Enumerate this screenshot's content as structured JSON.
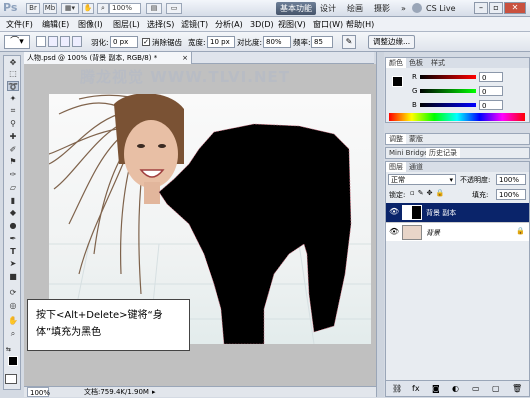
{
  "titlebar": {
    "logo": "Ps",
    "zoom": "100%",
    "workspaces": [
      "基本功能",
      "设计",
      "绘画",
      "摄影"
    ],
    "more": "»",
    "cs_live": "CS Live"
  },
  "menu": [
    "文件(F)",
    "编辑(E)",
    "图像(I)",
    "图层(L)",
    "选择(S)",
    "滤镜(T)",
    "分析(A)",
    "3D(D)",
    "视图(V)",
    "窗口(W)",
    "帮助(H)"
  ],
  "options": {
    "feather_label": "羽化:",
    "feather_value": "0 px",
    "antialias_label": "消除锯齿",
    "width_label": "宽度:",
    "width_value": "10 px",
    "contrast_label": "对比度:",
    "contrast_value": "80%",
    "frequency_label": "频率:",
    "frequency_value": "85",
    "refine_edge": "调整边缘..."
  },
  "document": {
    "tab_title": "人物.psd @ 100% (背景 副本, RGB/8) *",
    "watermark": "腾龙视觉 WWW.TLVI.NET",
    "zoom": "100%",
    "doc_info": "文档:759.4K/1.90M"
  },
  "callout": {
    "line1": "按下<Alt+Delete>键将“身",
    "line2": "体”填充为黑色"
  },
  "color_panel": {
    "tabs": [
      "颜色",
      "色板",
      "样式"
    ],
    "channels": [
      {
        "label": "R",
        "value": "0"
      },
      {
        "label": "G",
        "value": "0"
      },
      {
        "label": "B",
        "value": "0"
      }
    ]
  },
  "adjust_panel": {
    "tabs": [
      "调整",
      "蒙版"
    ]
  },
  "history_panel": {
    "tabs": [
      "Mini Bridge",
      "历史记录"
    ]
  },
  "layers_panel": {
    "tabs": [
      "图层",
      "通道"
    ],
    "blend_mode": "正常",
    "opacity_label": "不透明度:",
    "opacity_value": "100%",
    "lock_label": "锁定:",
    "fill_label": "填充:",
    "fill_value": "100%",
    "layers": [
      {
        "name": "背景 副本",
        "selected": true
      },
      {
        "name": "背景",
        "selected": false
      }
    ]
  },
  "colors": {
    "accent_selected_layer": "#0a246a",
    "workspace_active": "#4b5a70"
  }
}
